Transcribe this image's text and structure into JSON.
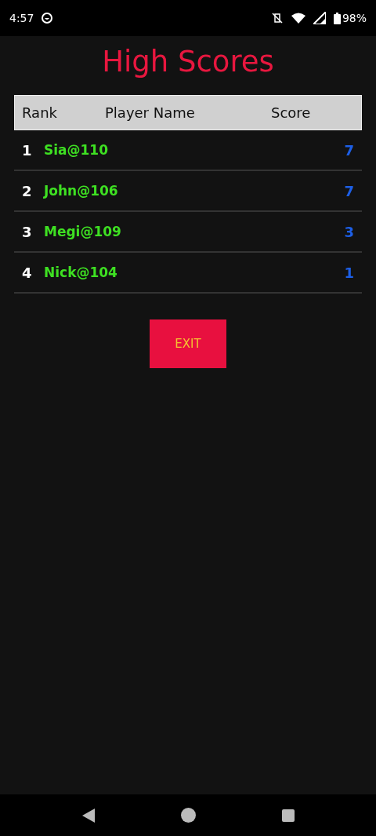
{
  "status_bar": {
    "time": "4:57",
    "battery": "98%"
  },
  "title": "High Scores",
  "table": {
    "columns": [
      "Rank",
      "Player Name",
      "Score"
    ],
    "rows": [
      {
        "rank": "1",
        "player": "Sia@110",
        "score": "7"
      },
      {
        "rank": "2",
        "player": "John@106",
        "score": "7"
      },
      {
        "rank": "3",
        "player": "Megi@109",
        "score": "3"
      },
      {
        "rank": "4",
        "player": "Nick@104",
        "score": "1"
      }
    ]
  },
  "exit_button": "EXIT"
}
